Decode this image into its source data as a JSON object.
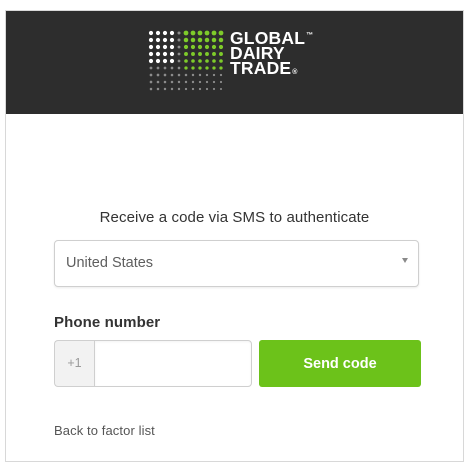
{
  "brand": {
    "logo_lines": [
      "GLOBAL",
      "DAIRY",
      "TRADE"
    ],
    "trademark_symbol": "™",
    "registered_symbol": "®",
    "colors": {
      "header_bg": "#2d2d2d",
      "dot_green": "#7ecb2a",
      "dot_white": "#ffffff",
      "dot_grey": "#8c8c8c"
    }
  },
  "form": {
    "heading": "Receive a code via SMS to authenticate",
    "country_select": {
      "value": "United States",
      "icon": "chevron-down-icon"
    },
    "phone_label": "Phone number",
    "phone_prefix": "+1",
    "phone_value": "",
    "send_button_label": "Send code",
    "accent_color": "#6cc21a"
  },
  "footer": {
    "back_link_label": "Back to factor list"
  }
}
